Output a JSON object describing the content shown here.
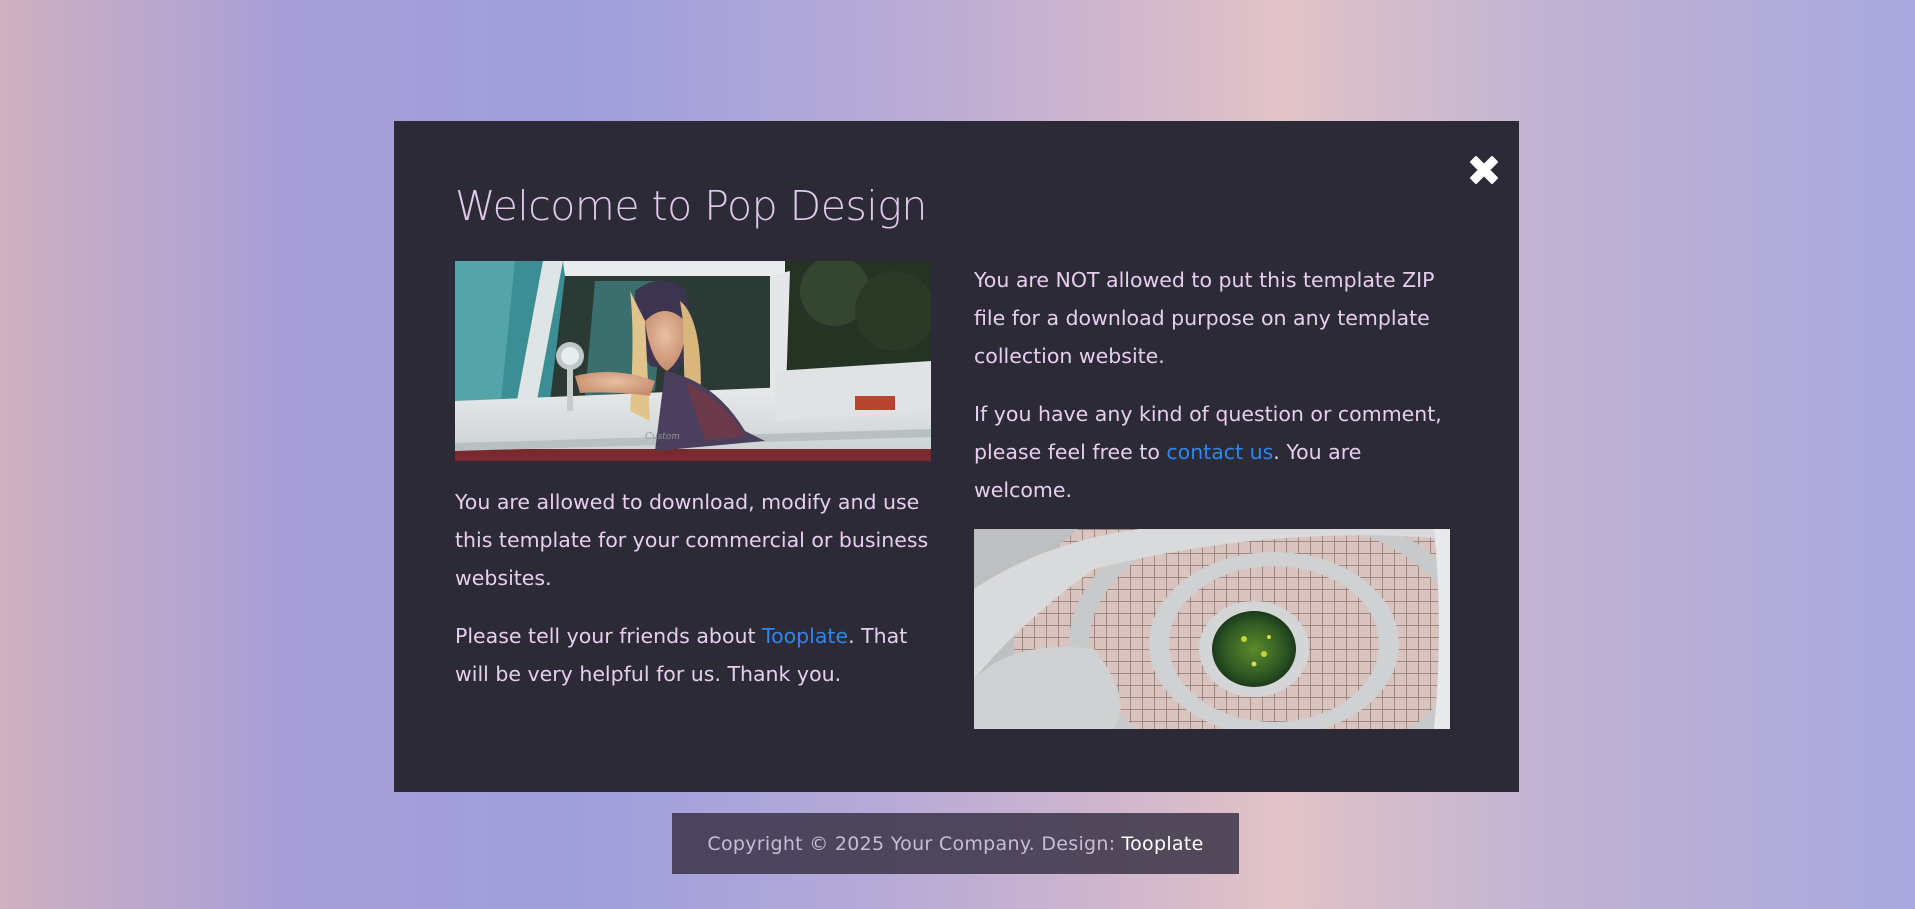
{
  "modal": {
    "title": "Welcome to Pop Design",
    "close_icon": "close-icon"
  },
  "left": {
    "image": "woman-in-truck-photo",
    "para1": "You are allowed to download, modify and use this template for your commercial or business websites.",
    "para2_before": "Please tell your friends about ",
    "para2_link": "Tooplate",
    "para2_after": ". That will be very helpful for us. Thank you."
  },
  "right": {
    "para1": "You are NOT allowed to put this template ZIP file for a download purpose on any template collection website.",
    "para2_before": "If you have any kind of question or comment, please feel free to ",
    "para2_link": "contact us",
    "para2_after": ". You are welcome.",
    "image": "spiral-staircase-photo"
  },
  "footer": {
    "copyright": "Copyright © 2025 Your Company. Design:",
    "design_link": "Tooplate"
  },
  "colors": {
    "modal_bg": "#2c2a37",
    "title": "#e1c9ea",
    "text": "#e6cfee",
    "link": "#2f86ee"
  }
}
